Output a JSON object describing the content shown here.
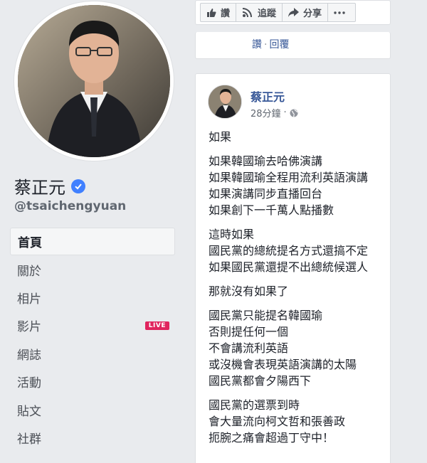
{
  "profile": {
    "name": "蔡正元",
    "handle": "@tsaichengyuan"
  },
  "nav": [
    {
      "label": "首頁",
      "active": true
    },
    {
      "label": "關於"
    },
    {
      "label": "相片"
    },
    {
      "label": "影片",
      "badge": "LIVE"
    },
    {
      "label": "網誌"
    },
    {
      "label": "活動"
    },
    {
      "label": "貼文"
    },
    {
      "label": "社群"
    }
  ],
  "actions": {
    "like": "讚",
    "follow": "追蹤",
    "share": "分享",
    "more_icon": "more-icon"
  },
  "comment": {
    "like": "讚",
    "reply": "回覆"
  },
  "post": {
    "author": "蔡正元",
    "time": "28分鐘",
    "paragraphs": [
      [
        "如果"
      ],
      [
        "如果韓國瑜去哈佛演講",
        "如果韓國瑜全程用流利英語演講",
        "如果演講同步直播回台",
        "如果創下一千萬人點播數"
      ],
      [
        "這時如果",
        "國民黨的總統提名方式還搞不定",
        "如果國民黨還提不出總統候選人"
      ],
      [
        "那就沒有如果了"
      ],
      [
        "國民黨只能提名韓國瑜",
        "否則提任何一個",
        "不會講流利英語",
        "或沒機會表現英語演講的太陽",
        "國民黨都會夕陽西下"
      ],
      [
        "國民黨的選票到時",
        "會大量流向柯文哲和張善政",
        "扼腕之痛會超過丁守中！"
      ]
    ]
  },
  "colors": {
    "link": "#385898",
    "live_badge": "#e0245e",
    "verified": "#4080ff"
  }
}
